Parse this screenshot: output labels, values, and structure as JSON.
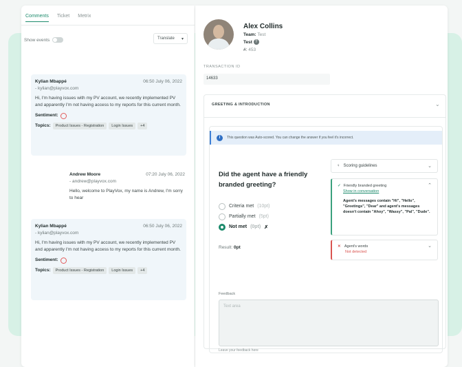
{
  "tabs": [
    {
      "label": "Comments",
      "active": true
    },
    {
      "label": "Ticket",
      "active": false
    },
    {
      "label": "Metrix",
      "active": false
    }
  ],
  "show_events_label": "Show events",
  "translate_label": "Translate",
  "messages": [
    {
      "name": "Kylian Mbappé",
      "time": "06:50 July 06, 2022",
      "email": "- kylian@playvox.com",
      "text": "Hi, I'm having issues with my PV account, we recently implemented PV and apparently I'm not having access to my reports for this current month.",
      "sentiment_label": "Sentiment:",
      "topics_label": "Topics:",
      "topics": [
        "Product Issues - Registration",
        "Login Issues",
        "+4"
      ]
    },
    {
      "name": "Andrew Moore",
      "time": "07:20 July 06, 2022",
      "email": "- andrew@playvox.com",
      "text": "Hello, welcome to PlayVox, my name is Andrew, I'm sorry to hear"
    },
    {
      "name": "Kylian Mbappé",
      "time": "06:50 July 06, 2022",
      "email": "- kylian@playvox.com",
      "text": "Hi, I'm having issues with my PV account, we recently implemented PV and apparently I'm not having access to my reports for this current month.",
      "sentiment_label": "Sentiment:",
      "topics_label": "Topics:",
      "topics": [
        "Product Issues - Registration",
        "Login Issues",
        "+4"
      ]
    }
  ],
  "agent": {
    "name": "Alex Collins",
    "team_label": "Team:",
    "team": "Test",
    "test_label": "Test",
    "id_prefix": "#:",
    "id": "453"
  },
  "transaction": {
    "label": "TRANSACTION ID",
    "value": "14633"
  },
  "section": {
    "title": "GREETING & INTRODUCTION",
    "banner": "This question was Auto-scored. You can change the answer if you feel it's incorrect.",
    "question": "Did the agent have a friendly branded greeting?",
    "options": [
      {
        "label": "Criteria met",
        "pts": "(10pt)",
        "selected": false
      },
      {
        "label": "Partially met",
        "pts": "(5pt)",
        "selected": false
      },
      {
        "label": "Not met",
        "pts": "(0pt)",
        "selected": true
      }
    ],
    "result_label": "Result:",
    "result_value": "0pt",
    "scoring_guidelines": "Scoring guidelines",
    "criteria_title": "Friendly branded greeting",
    "criteria_link": "Show in conversation",
    "criteria_rule": "Agent's messages contain \"Hi\", \"Hello\", \"Greetings\", \"Dear\" and agent's messages doesn't contain \"Ahoy\", \"Wassy\", \"Pal\", \"Dude\".",
    "criteria2_title": "Agent's words",
    "criteria2_status": "Not detected",
    "feedback_label": "Feedback",
    "feedback_placeholder": "Text area",
    "feedback_help": "Leave your feedback here"
  }
}
